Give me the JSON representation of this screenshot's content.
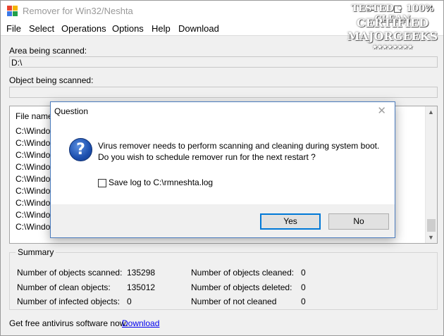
{
  "window": {
    "title": "Remover for Win32/Neshta",
    "controls": {
      "minimize": "—",
      "maximize": "☐",
      "close": "✕"
    }
  },
  "menu": [
    "File",
    "Select",
    "Operations",
    "Options",
    "Help",
    "Download"
  ],
  "area": {
    "label": "Area being scanned:",
    "value": "D:\\"
  },
  "object": {
    "label": "Object being scanned:",
    "value": ""
  },
  "list": {
    "header": "File name",
    "rows": [
      "C:\\Window",
      "C:\\Window",
      "C:\\Window",
      "C:\\Window",
      "C:\\Window",
      "C:\\Window",
      "C:\\Window",
      "C:\\Window",
      "C:\\Window"
    ]
  },
  "summary": {
    "legend": "Summary",
    "left": [
      {
        "label": "Number of objects scanned:",
        "value": "135298"
      },
      {
        "label": "Number of clean objects:",
        "value": "135012"
      },
      {
        "label": "Number of infected objects:",
        "value": "0"
      }
    ],
    "right": [
      {
        "label": "Number of objects cleaned:",
        "value": "0"
      },
      {
        "label": "Number of objects deleted:",
        "value": "0"
      },
      {
        "label": "Number of not cleaned",
        "value": "0"
      }
    ]
  },
  "footer": {
    "text": "Get free antivirus software now:",
    "link": "Download"
  },
  "watermark": {
    "line1": "TESTED • 100% CLEAN",
    "line2": "CERTIFIED",
    "line3": "MAJORGEEKS",
    "stars": "★★★★★★★★"
  },
  "dialog": {
    "title": "Question",
    "close": "✕",
    "icon": "?",
    "message_line1": "Virus remover needs to perform scanning and cleaning during system boot.",
    "message_line2": "Do you wish to schedule remover run for the next restart ?",
    "checkbox_label": "Save log to C:\\rmneshta.log",
    "yes": "Yes",
    "no": "No"
  },
  "colors": {
    "accent": "#0078d7",
    "dialog_border": "#4a7bbd",
    "link": "#0000ee",
    "icon_blue": "#1c4fae"
  }
}
